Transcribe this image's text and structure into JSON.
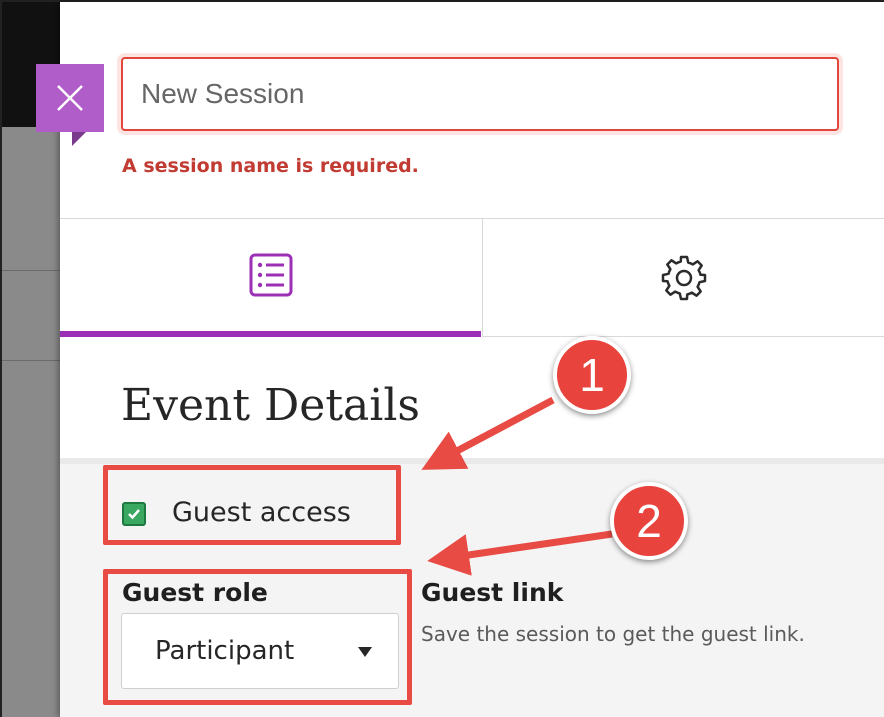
{
  "header": {
    "session_name": {
      "value": "",
      "placeholder": "New Session"
    },
    "error": "A session name is required."
  },
  "tabs": [
    {
      "icon": "list-icon",
      "selected": true
    },
    {
      "icon": "gear-icon",
      "selected": false
    }
  ],
  "section": {
    "title": "Event Details"
  },
  "guest_access": {
    "label": "Guest access",
    "checked": true
  },
  "guest_role": {
    "label": "Guest role",
    "selected": "Participant"
  },
  "guest_link": {
    "label": "Guest link",
    "hint": "Save the session to get the guest link."
  },
  "annotations": [
    {
      "number": "1"
    },
    {
      "number": "2"
    }
  ],
  "colors": {
    "accent": "#9b2fb6",
    "close_button": "#b05dc9",
    "error": "#c23b33",
    "checkbox": "#3aa861",
    "annotation": "#e84a44"
  }
}
